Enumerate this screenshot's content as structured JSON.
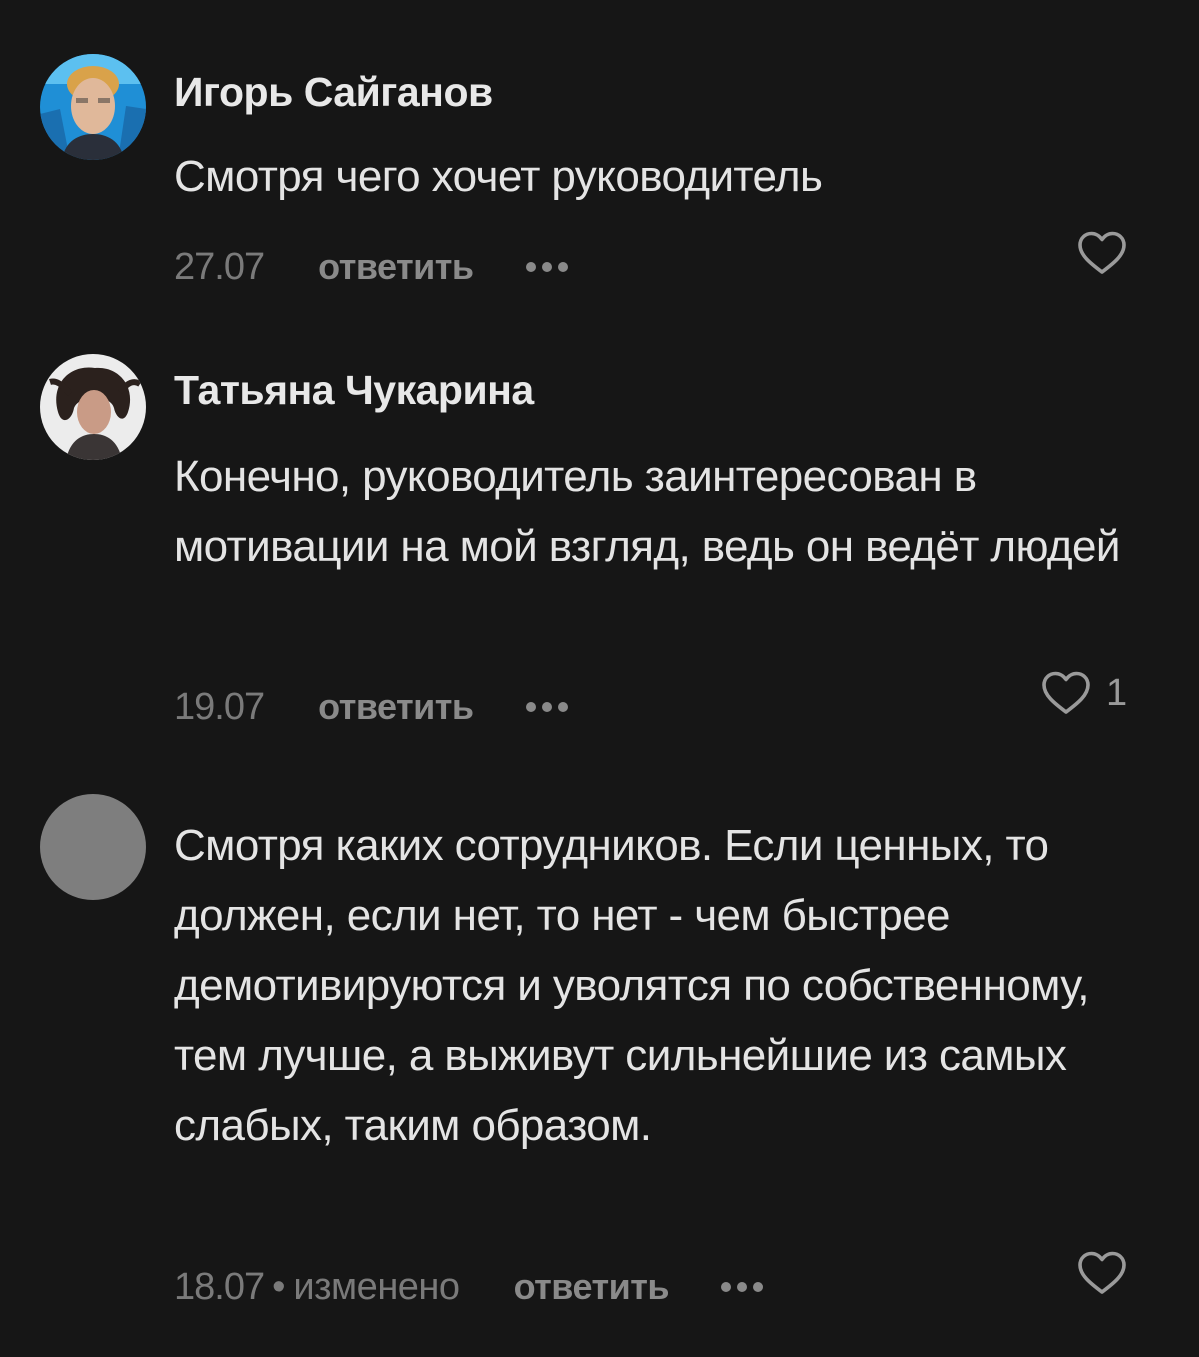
{
  "comments": [
    {
      "author": "Игорь Сайганов",
      "avatar": "user-photo-avatar",
      "text": "Смотря чего хочет руководитель",
      "date": "27.07",
      "edited_label": "",
      "reply_label": "ответить",
      "more_icon": "more-dots-icon",
      "like_icon": "heart-outline-icon",
      "like_count": ""
    },
    {
      "author": "Татьяна Чукарина",
      "avatar": "user-photo-avatar",
      "text": "Конечно, руководитель заинтересован в мотивации на мой взгляд, ведь он ведёт людей",
      "date": "19.07",
      "edited_label": "",
      "reply_label": "ответить",
      "more_icon": "more-dots-icon",
      "like_icon": "heart-outline-icon",
      "like_count": "1"
    },
    {
      "author": "",
      "avatar": "placeholder-avatar",
      "text": "Смотря каких сотрудников. Если ценных, то должен, если нет, то нет - чем быстрее демотивируются и уволятся по собственному, тем лучше, а выживут сильнейшие из самых слабых, таким образом.",
      "date": "18.07",
      "separator": "•",
      "edited_label": "изменено",
      "reply_label": "ответить",
      "more_icon": "more-dots-icon",
      "like_icon": "heart-outline-icon",
      "like_count": ""
    }
  ],
  "colors": {
    "background": "#161616",
    "text": "#e4e4e4",
    "muted": "#7a7a7a",
    "action": "#8a8a8a",
    "placeholder_avatar": "#7e7e7e"
  }
}
